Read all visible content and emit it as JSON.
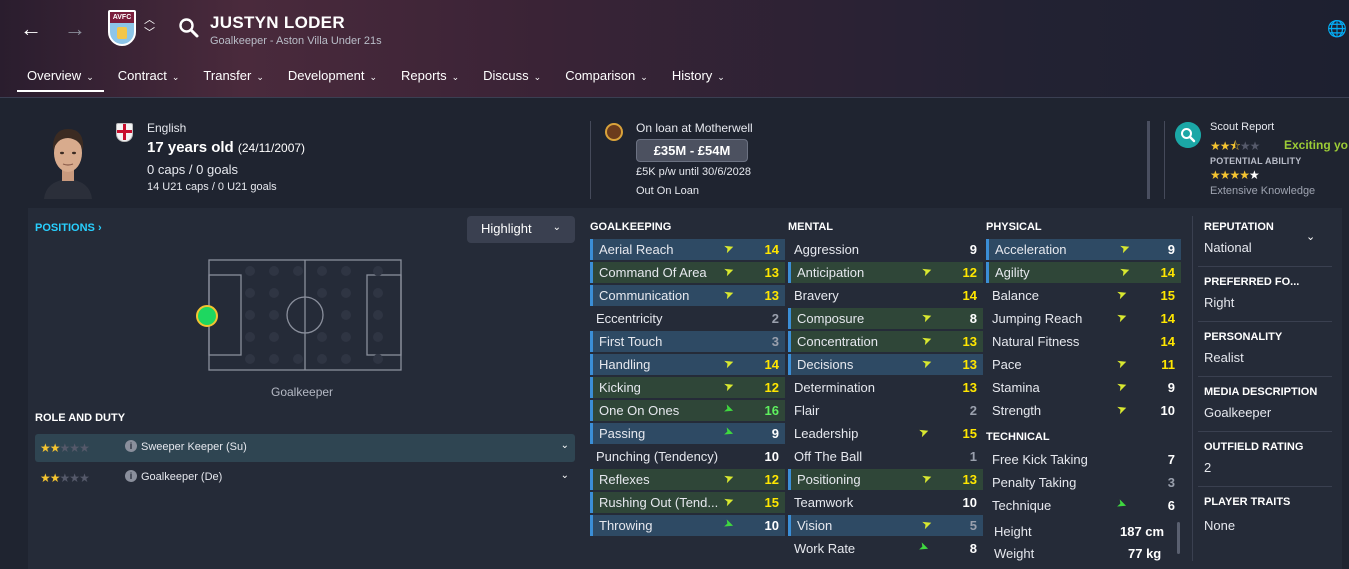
{
  "header": {
    "player_name": "JUSTYN LODER",
    "subtitle": "Goalkeeper - Aston Villa Under 21s",
    "club_crest_text": "AVFC",
    "tabs": [
      {
        "label": "Overview",
        "active": true
      },
      {
        "label": "Contract"
      },
      {
        "label": "Transfer"
      },
      {
        "label": "Development"
      },
      {
        "label": "Reports"
      },
      {
        "label": "Discuss"
      },
      {
        "label": "Comparison"
      },
      {
        "label": "History"
      }
    ]
  },
  "profile": {
    "nationality": "English",
    "age": "17 years old",
    "dob": "(24/11/2007)",
    "caps": "0 caps / 0 goals",
    "u21_caps": "14 U21 caps / 0 U21 goals"
  },
  "loan": {
    "status": "On loan at Motherwell",
    "value": "£35M - £54M",
    "wage": "£5K p/w until 30/6/2028",
    "availability": "Out On Loan"
  },
  "scout": {
    "title": "Scout Report",
    "verdict": "Exciting yo",
    "current_stars": 2.5,
    "potential_label": "POTENTIAL ABILITY",
    "potential_stars": 4,
    "knowledge": "Extensive Knowledge"
  },
  "positions": {
    "title": "POSITIONS",
    "highlight_label": "Highlight",
    "position_label": "Goalkeeper"
  },
  "roles": {
    "title": "ROLE AND DUTY",
    "items": [
      {
        "name": "Sweeper Keeper (Su)",
        "stars": 2,
        "selected": true
      },
      {
        "name": "Goalkeeper (De)",
        "stars": 2,
        "selected": false
      }
    ]
  },
  "goalkeeping": {
    "title": "GOALKEEPING",
    "rows": [
      {
        "name": "Aerial Reach",
        "value": "14"
      },
      {
        "name": "Command Of Area",
        "value": "13"
      },
      {
        "name": "Communication",
        "value": "13"
      },
      {
        "name": "Eccentricity",
        "value": "2"
      },
      {
        "name": "First Touch",
        "value": "3"
      },
      {
        "name": "Handling",
        "value": "14"
      },
      {
        "name": "Kicking",
        "value": "12"
      },
      {
        "name": "One On Ones",
        "value": "16"
      },
      {
        "name": "Passing",
        "value": "9"
      },
      {
        "name": "Punching (Tendency)",
        "value": "10"
      },
      {
        "name": "Reflexes",
        "value": "12"
      },
      {
        "name": "Rushing Out (Tend...",
        "value": "15"
      },
      {
        "name": "Throwing",
        "value": "10"
      }
    ]
  },
  "mental": {
    "title": "MENTAL",
    "rows": [
      {
        "name": "Aggression",
        "value": "9"
      },
      {
        "name": "Anticipation",
        "value": "12"
      },
      {
        "name": "Bravery",
        "value": "14"
      },
      {
        "name": "Composure",
        "value": "8"
      },
      {
        "name": "Concentration",
        "value": "13"
      },
      {
        "name": "Decisions",
        "value": "13"
      },
      {
        "name": "Determination",
        "value": "13"
      },
      {
        "name": "Flair",
        "value": "2"
      },
      {
        "name": "Leadership",
        "value": "15"
      },
      {
        "name": "Off The Ball",
        "value": "1"
      },
      {
        "name": "Positioning",
        "value": "13"
      },
      {
        "name": "Teamwork",
        "value": "10"
      },
      {
        "name": "Vision",
        "value": "5"
      },
      {
        "name": "Work Rate",
        "value": "8"
      }
    ]
  },
  "physical": {
    "title": "PHYSICAL",
    "rows": [
      {
        "name": "Acceleration",
        "value": "9"
      },
      {
        "name": "Agility",
        "value": "14"
      },
      {
        "name": "Balance",
        "value": "15"
      },
      {
        "name": "Jumping Reach",
        "value": "14"
      },
      {
        "name": "Natural Fitness",
        "value": "14"
      },
      {
        "name": "Pace",
        "value": "11"
      },
      {
        "name": "Stamina",
        "value": "9"
      },
      {
        "name": "Strength",
        "value": "10"
      }
    ]
  },
  "technical": {
    "title": "TECHNICAL",
    "rows": [
      {
        "name": "Free Kick Taking",
        "value": "7"
      },
      {
        "name": "Penalty Taking",
        "value": "3"
      },
      {
        "name": "Technique",
        "value": "6"
      }
    ],
    "height_label": "Height",
    "height": "187 cm",
    "weight_label": "Weight",
    "weight": "77 kg"
  },
  "sidebar": {
    "reputation_label": "REPUTATION",
    "reputation": "National",
    "foot_label": "PREFERRED FO...",
    "foot": "Right",
    "personality_label": "PERSONALITY",
    "personality": "Realist",
    "media_label": "MEDIA DESCRIPTION",
    "media": "Goalkeeper",
    "outfield_label": "OUTFIELD RATING",
    "outfield": "2",
    "traits_label": "PLAYER TRAITS",
    "traits": "None"
  }
}
